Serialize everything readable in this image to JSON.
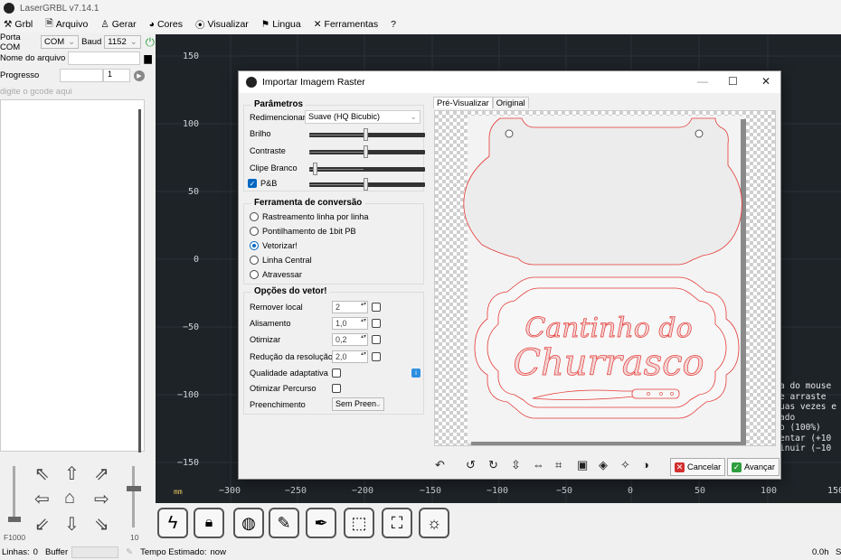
{
  "window": {
    "title": "LaserGRBL v7.14.1"
  },
  "menu": [
    "Grbl",
    "Arquivo",
    "Gerar",
    "Cores",
    "Visualizar",
    "Lingua",
    "Ferramentas",
    "?"
  ],
  "left": {
    "port_label": "Porta COM",
    "port_value": "COM",
    "baud_label": "Baud",
    "baud_value": "1152",
    "file_label": "Nome do arquivo",
    "progress_label": "Progresso",
    "progress_count": "1",
    "gcode_placeholder": "digite o gcode aqui",
    "speed_label": "F1000",
    "step_label": "10"
  },
  "plot": {
    "y_ticks": [
      "150",
      "100",
      "50",
      "0",
      "−50",
      "−100",
      "−150"
    ],
    "x_ticks": [
      "−300",
      "−250",
      "−200",
      "−150",
      "−100",
      "−50",
      "0",
      "50",
      "100",
      "150"
    ],
    "unit": "mm",
    "console": [
      "a do mouse",
      "e arraste",
      "uas vezes e",
      "",
      "ado",
      "o (100%)",
      "entar (+10",
      "inuir (−10"
    ]
  },
  "status": {
    "lines_label": "Linhas:",
    "lines_value": "0",
    "buffer_label": "Buffer",
    "time_label": "Tempo Estimado:",
    "time_value": "now",
    "right_value": "0.0h",
    "right_cut": "S"
  },
  "dialog": {
    "title": "Importar Imagem Raster",
    "params_title": "Parâmetros",
    "resize_label": "Redimencionar",
    "resize_value": "Suave (HQ Bicubic)",
    "brightness_label": "Brilho",
    "contrast_label": "Contraste",
    "white_clip_label": "Clipe Branco",
    "bw_label": "P&B",
    "conversion_title": "Ferramenta de conversão",
    "conversion_options": [
      "Rastreamento linha por linha",
      "Pontilhamento de 1bit PB",
      "Vetorizar!",
      "Linha Central",
      "Atravessar"
    ],
    "conversion_selected": 2,
    "vector_title": "Opções do vetor!",
    "remove_label": "Remover local",
    "remove_value": "2",
    "smooth_label": "Alisamento",
    "smooth_value": "1,0",
    "optimize_label": "Otimizar",
    "optimize_value": "0,2",
    "resolution_label": "Redução da resolução",
    "resolution_value": "2,0",
    "adaptive_label": "Qualidade adaptativa",
    "optimize_path_label": "Otimizar Percurso",
    "fill_label": "Preenchimento",
    "fill_value": "Sem Preen",
    "tab_preview": "Pré-Visualizar",
    "tab_original": "Original",
    "preview_text_1": "Cantinho do",
    "preview_text_2": "Churrasco",
    "cancel_label": "Cancelar",
    "next_label": "Avançar"
  },
  "colors": {
    "plot_bg": "#1e2328",
    "vector_red": "#e53935",
    "accent": "#0067c0",
    "cancel": "#d32f2f",
    "next": "#2e9e3e"
  }
}
